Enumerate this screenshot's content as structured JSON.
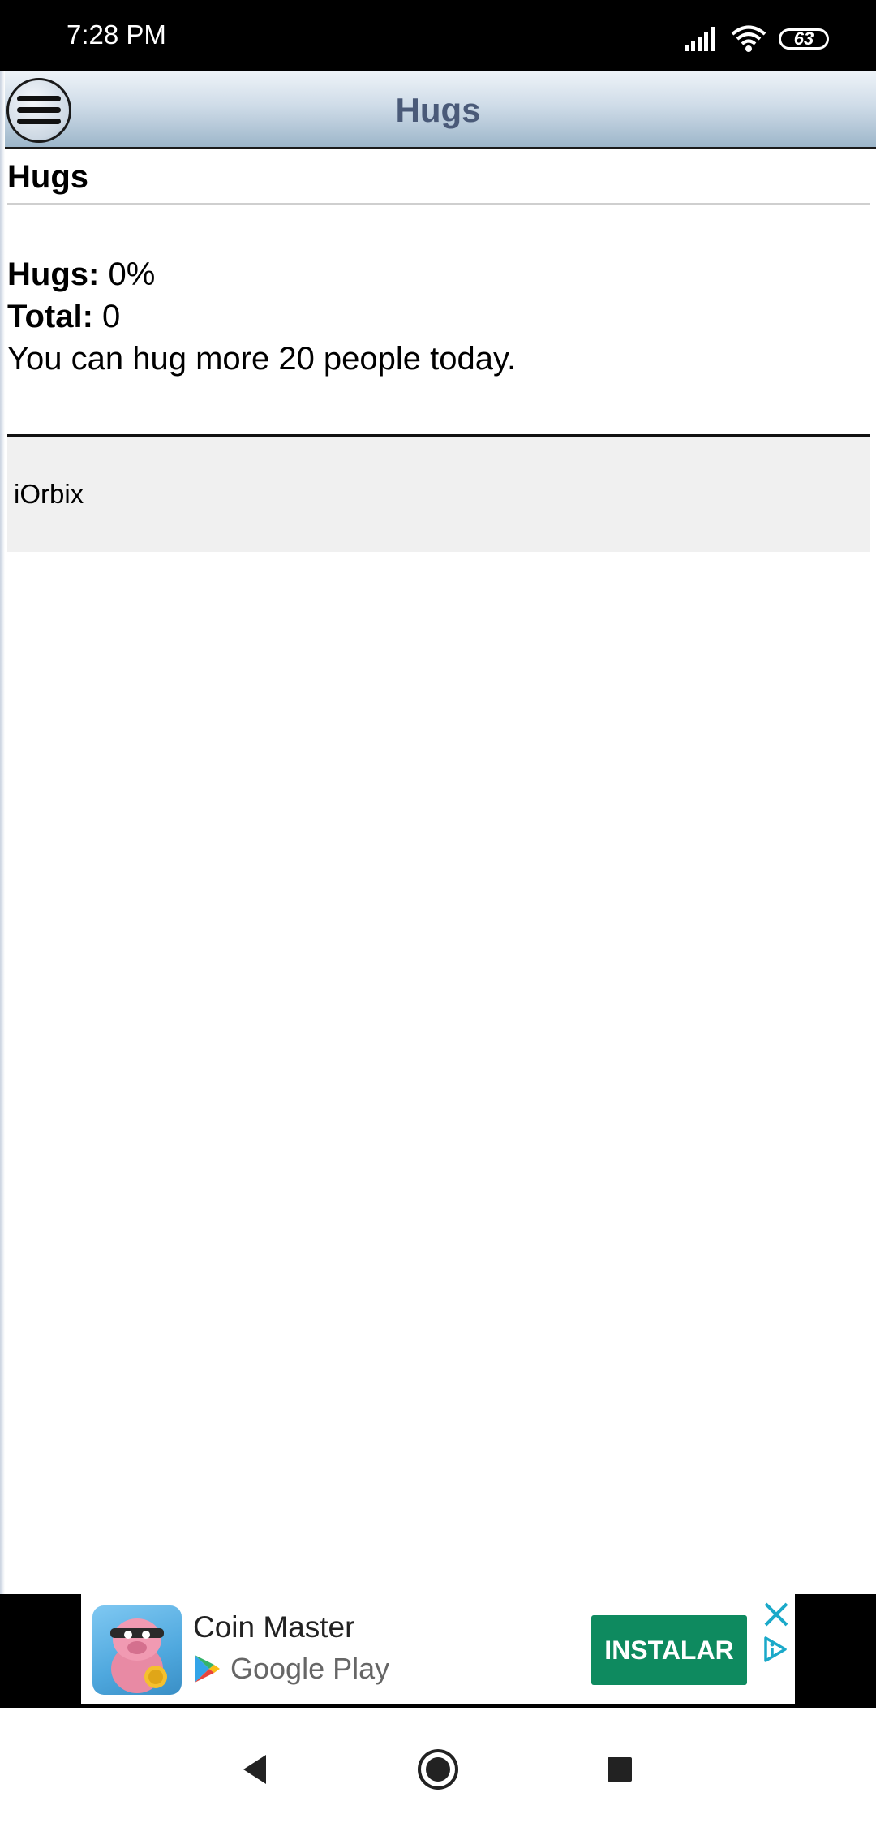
{
  "status_bar": {
    "time": "7:28 PM",
    "battery": "63",
    "icons": [
      "signal-icon",
      "wifi-icon",
      "battery-icon"
    ]
  },
  "header": {
    "title": "Hugs",
    "menu_icon": "hamburger-menu-icon"
  },
  "content": {
    "heading": "Hugs",
    "stats": [
      {
        "label": "Hugs:",
        "value": "0%"
      },
      {
        "label": "Total:",
        "value": "0"
      }
    ],
    "message": "You can hug more 20 people today."
  },
  "list": {
    "items": [
      {
        "name": "iOrbix"
      }
    ]
  },
  "ad": {
    "app_name": "Coin Master",
    "store": "Google Play",
    "install_label": "INSTALAR",
    "close_icon": "close-icon",
    "adchoices_icon": "adchoices-icon",
    "accent": "#0e8a5f"
  },
  "nav": {
    "back_icon": "back-triangle-icon",
    "home_icon": "home-circle-icon",
    "recents_icon": "recents-square-icon"
  },
  "colors": {
    "header_title": "#4a5a78",
    "install_button": "#0e8a5f",
    "ad_close": "#1ba9c9"
  }
}
